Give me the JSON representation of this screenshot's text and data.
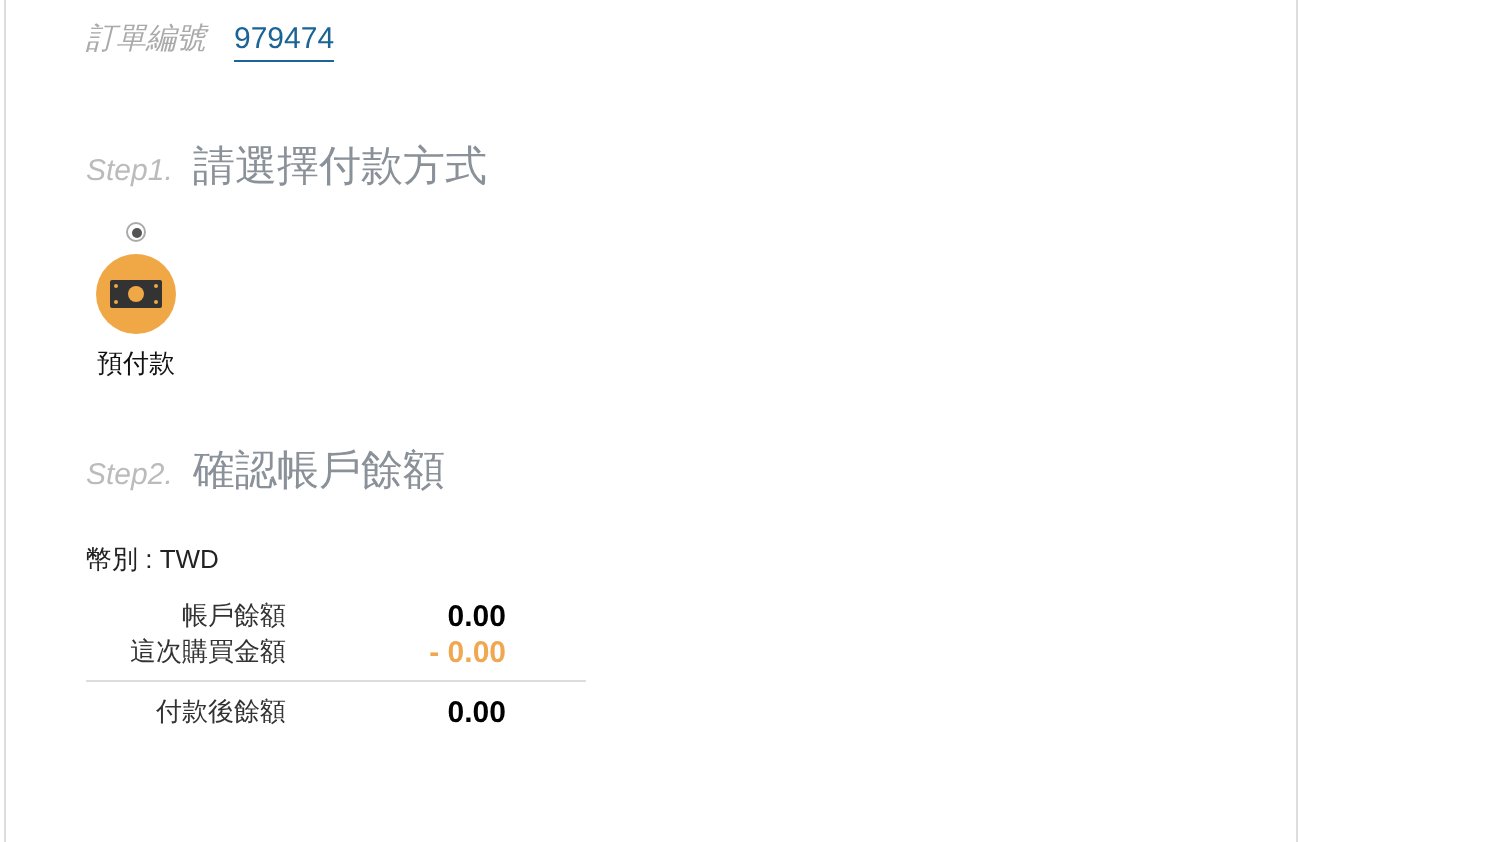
{
  "order": {
    "label": "訂單編號",
    "number": "979474"
  },
  "step1": {
    "step": "Step1.",
    "title": "請選擇付款方式"
  },
  "payment_methods": [
    {
      "label": "預付款",
      "selected": true
    }
  ],
  "step2": {
    "step": "Step2.",
    "title": "確認帳戶餘額"
  },
  "currency": "幣別 : TWD",
  "balance_rows": [
    {
      "label": "帳戶餘額",
      "value": "0.00",
      "kind": "plain"
    },
    {
      "label": "這次購買金額",
      "value": "- 0.00",
      "kind": "deduct"
    },
    {
      "label": "付款後餘額",
      "value": "0.00",
      "kind": "total"
    }
  ]
}
